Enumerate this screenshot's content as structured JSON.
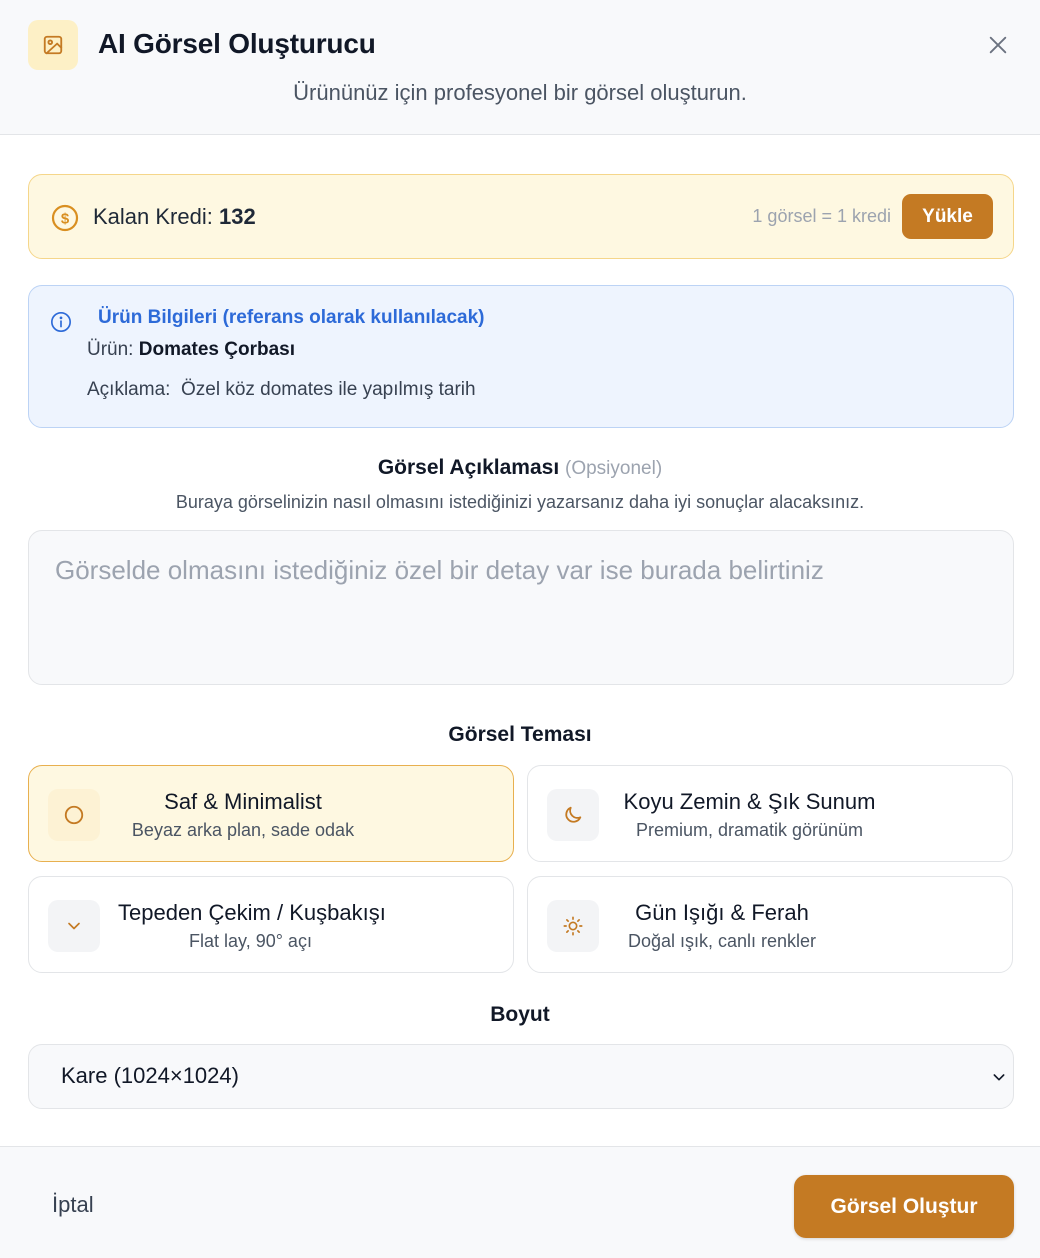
{
  "header": {
    "title": "AI Görsel Oluşturucu",
    "subtitle": "Ürününüz için profesyonel bir görsel oluşturun.",
    "icon": "image-icon",
    "close_icon": "close-icon"
  },
  "credit": {
    "label": "Kalan Kredi:",
    "value": "132",
    "rate": "1 görsel = 1 kredi",
    "load_button": "Yükle",
    "icon": "dollar-coin-icon"
  },
  "product_info": {
    "title": "Ürün Bilgileri (referans olarak kullanılacak)",
    "product_label": "Ürün:",
    "product_value": "Domates Çorbası",
    "description_label": "Açıklama:",
    "description_value": "Özel köz domates ile yapılmış tarih",
    "icon": "info-icon"
  },
  "image_description": {
    "title": "Görsel Açıklaması",
    "optional": "(Opsiyonel)",
    "hint": "Buraya görselinizin nasıl olmasını istediğinizi yazarsanız daha iyi sonuçlar alacaksınız.",
    "placeholder": "Görselde olmasını istediğiniz özel bir detay var ise burada belirtiniz",
    "value": ""
  },
  "theme": {
    "title": "Görsel Teması",
    "options": [
      {
        "name": "Saf & Minimalist",
        "description": "Beyaz arka plan, sade odak",
        "icon": "circle-icon",
        "selected": true
      },
      {
        "name": "Koyu Zemin & Şık Sunum",
        "description": "Premium, dramatik görünüm",
        "icon": "moon-icon",
        "selected": false
      },
      {
        "name": "Tepeden Çekim / Kuşbakışı",
        "description": "Flat lay, 90° açı",
        "icon": "chevron-down-icon",
        "selected": false
      },
      {
        "name": "Gün Işığı & Ferah",
        "description": "Doğal ışık, canlı renkler",
        "icon": "sun-icon",
        "selected": false
      }
    ]
  },
  "size": {
    "title": "Boyut",
    "selected": "Kare (1024×1024)"
  },
  "footer": {
    "cancel": "İptal",
    "create": "Görsel Oluştur"
  },
  "colors": {
    "accent": "#c47a23",
    "accent_light": "#fef8e1",
    "info_bg": "#eef4fe",
    "info_text": "#2d6ad8"
  }
}
